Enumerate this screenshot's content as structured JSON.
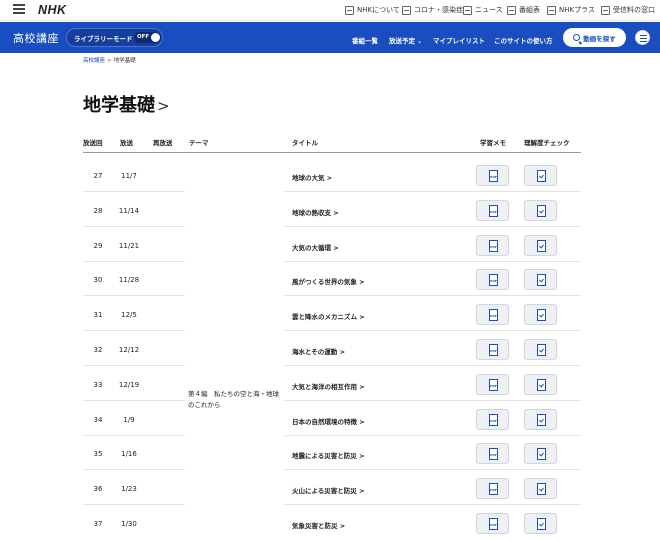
{
  "topbar": {
    "logo": "NHK",
    "links": [
      {
        "label": "NHKについて",
        "icon": "building-icon"
      },
      {
        "label": "コロナ・感染症",
        "icon": "info-icon"
      },
      {
        "label": "ニュース",
        "icon": "newspaper-icon"
      },
      {
        "label": "番組表",
        "icon": "calendar-icon"
      },
      {
        "label": "NHKプラス",
        "icon": "tv-icon"
      },
      {
        "label": "受信料の窓口",
        "icon": "key-icon"
      }
    ]
  },
  "header": {
    "brand": "高校講座",
    "library_mode": {
      "label": "ライブラリーモード",
      "state": "OFF"
    },
    "nav": [
      "番組一覧",
      "放送予定",
      "マイプレイリスト",
      "このサイトの使い方"
    ],
    "search_label": "動画を探す",
    "accent_color": "#1a4ec0"
  },
  "breadcrumb": [
    "高校講座",
    "地学基礎"
  ],
  "page_title": "地学基礎",
  "table": {
    "columns": [
      "放送回",
      "放送",
      "再放送",
      "テーマ",
      "タイトル",
      "学習メモ",
      "理解度チェック"
    ],
    "theme": "第４編　私たちの空と海・地球のこれから",
    "rows": [
      {
        "no": "27",
        "date": "11/7",
        "title": "地球の大気 >"
      },
      {
        "no": "28",
        "date": "11/14",
        "title": "地球の熱収支 >"
      },
      {
        "no": "29",
        "date": "11/21",
        "title": "大気の大循環 >"
      },
      {
        "no": "30",
        "date": "11/28",
        "title": "風がつくる世界の気象 >"
      },
      {
        "no": "31",
        "date": "12/5",
        "title": "雲と降水のメカニズム >"
      },
      {
        "no": "32",
        "date": "12/12",
        "title": "海水とその運動 >"
      },
      {
        "no": "33",
        "date": "12/19",
        "title": "大気と海洋の相互作用 >"
      },
      {
        "no": "34",
        "date": "1/9",
        "title": "日本の自然環境の特徴 >"
      },
      {
        "no": "35",
        "date": "1/16",
        "title": "地震による災害と防災 >"
      },
      {
        "no": "36",
        "date": "1/23",
        "title": "火山による災害と防災 >"
      },
      {
        "no": "37",
        "date": "1/30",
        "title": "気象災害と防災 >"
      }
    ],
    "memo_icon": "pdf-icon",
    "check_icon": "checklist-icon",
    "memo_icon_text": "PDF"
  }
}
